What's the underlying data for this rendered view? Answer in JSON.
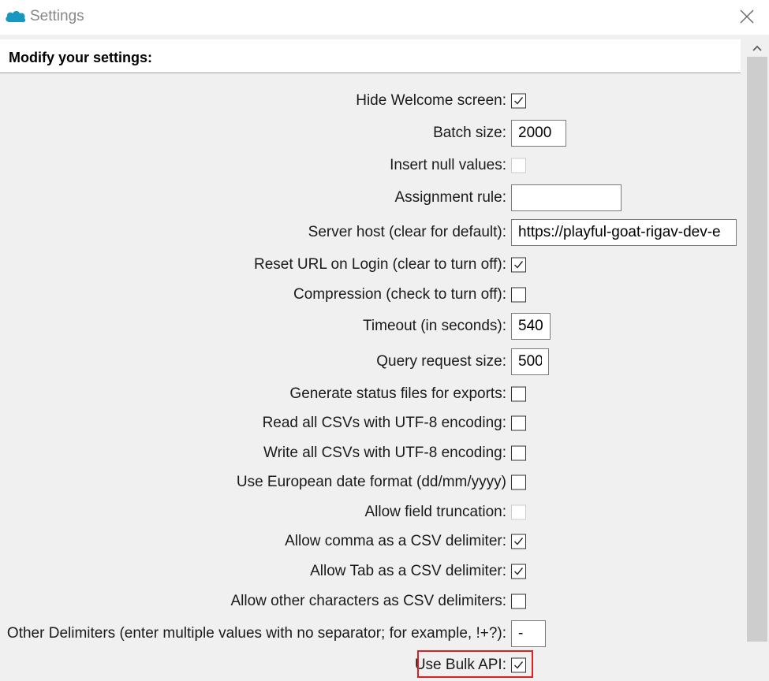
{
  "window": {
    "title": "Settings",
    "app_icon": "salesforce-cloud-icon",
    "close_icon": "close-icon"
  },
  "header": {
    "title": "Modify your settings:"
  },
  "settings": [
    {
      "label": "Hide Welcome screen:",
      "type": "checkbox",
      "checked": true,
      "enabled": true
    },
    {
      "label": "Batch size:",
      "type": "text",
      "value": "2000"
    },
    {
      "label": "Insert null values:",
      "type": "checkbox",
      "checked": false,
      "enabled": false
    },
    {
      "label": "Assignment rule:",
      "type": "text",
      "value": ""
    },
    {
      "label": "Server host (clear for default):",
      "type": "text",
      "value": "https://playful-goat-rigav-dev-e"
    },
    {
      "label": "Reset URL on Login (clear to turn off):",
      "type": "checkbox",
      "checked": true,
      "enabled": true
    },
    {
      "label": "Compression (check to turn off):",
      "type": "checkbox",
      "checked": false,
      "enabled": true
    },
    {
      "label": "Timeout (in seconds):",
      "type": "text",
      "value": "540"
    },
    {
      "label": "Query request size:",
      "type": "text",
      "value": "500"
    },
    {
      "label": "Generate status files for exports:",
      "type": "checkbox",
      "checked": false,
      "enabled": true
    },
    {
      "label": "Read all CSVs with UTF-8 encoding:",
      "type": "checkbox",
      "checked": false,
      "enabled": true
    },
    {
      "label": "Write all CSVs with UTF-8 encoding:",
      "type": "checkbox",
      "checked": false,
      "enabled": true
    },
    {
      "label": "Use European date format (dd/mm/yyyy)",
      "type": "checkbox",
      "checked": false,
      "enabled": true
    },
    {
      "label": "Allow field truncation:",
      "type": "checkbox",
      "checked": false,
      "enabled": false
    },
    {
      "label": "Allow comma as a CSV delimiter:",
      "type": "checkbox",
      "checked": true,
      "enabled": true
    },
    {
      "label": "Allow Tab as a CSV delimiter:",
      "type": "checkbox",
      "checked": true,
      "enabled": true
    },
    {
      "label": "Allow other characters as CSV delimiters:",
      "type": "checkbox",
      "checked": false,
      "enabled": true
    },
    {
      "label": "Other Delimiters (enter multiple values with no separator; for example, !+?):",
      "type": "text",
      "value": "-"
    },
    {
      "label": "Use Bulk API:",
      "type": "checkbox",
      "checked": true,
      "enabled": true,
      "highlighted": true
    }
  ],
  "colors": {
    "highlight": "#e02020",
    "accent_cloud": "#1798c1"
  }
}
